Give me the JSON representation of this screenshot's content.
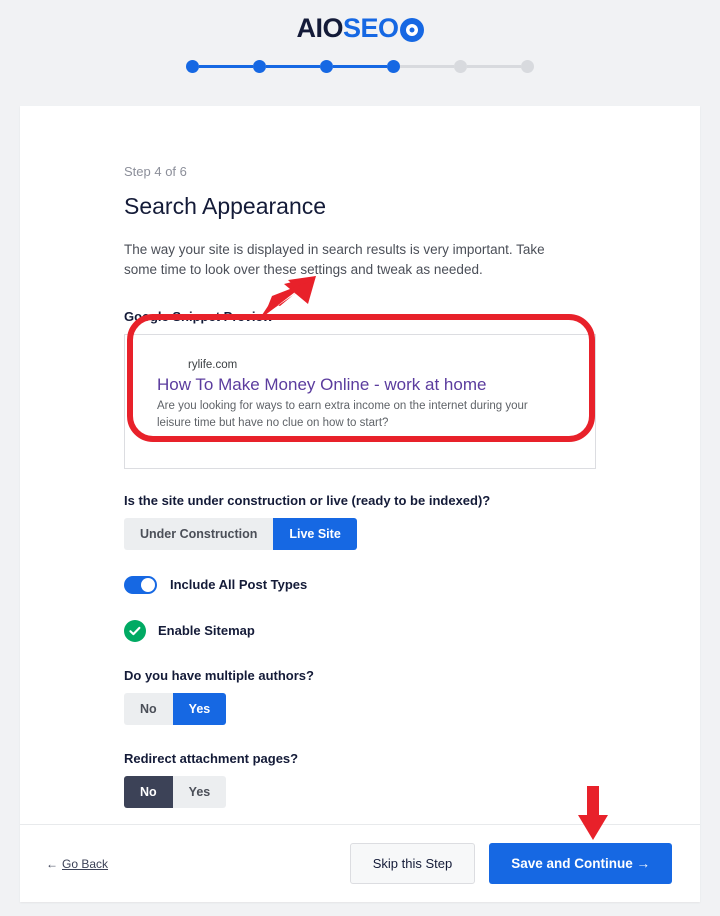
{
  "brand": {
    "name_part1": "AIO",
    "name_part2": "SEO",
    "gear_icon": "gear-icon",
    "color_dark": "#141b38",
    "color_blue": "#1668e3"
  },
  "stepper": {
    "total_steps": 6,
    "completed": 4,
    "dots": [
      "done",
      "done",
      "done",
      "done",
      "todo",
      "todo"
    ]
  },
  "main": {
    "step_label": "Step 4 of 6",
    "title": "Search Appearance",
    "intro": "The way your site is displayed in search results is very important. Take some time to look over these settings and tweak as needed.",
    "snippet_section_label": "Google Snippet Preview",
    "snippet": {
      "url": "rylife.com",
      "title": "How To Make Money Online - work at home",
      "description": "Are you looking for ways to earn extra income on the internet during your leisure time but have no clue on how to start?",
      "title_color": "#5b3c9e"
    },
    "questions": [
      {
        "label": "Is the site under construction or live (ready to be indexed)?",
        "options": [
          "Under Construction",
          "Live Site"
        ],
        "selected": "Live Site",
        "selected_style": "blue"
      },
      {
        "label": "Do you have multiple authors?",
        "options": [
          "No",
          "Yes"
        ],
        "selected": "Yes",
        "selected_style": "blue"
      },
      {
        "label": "Redirect attachment pages?",
        "options": [
          "No",
          "Yes"
        ],
        "selected": "No",
        "selected_style": "dark"
      }
    ],
    "switch_setting": {
      "label": "Include All Post Types",
      "state": "on",
      "color": "#1668e3"
    },
    "check_setting": {
      "label": "Enable Sitemap",
      "state": "checked",
      "color": "#00aa63"
    }
  },
  "footer": {
    "back_arrow": "←",
    "back_label": "Go Back",
    "skip_label": "Skip this Step",
    "primary_label": "Save and Continue →"
  },
  "annotations": {
    "highlight_color": "#e8212a",
    "arrow_to_snippet": "red-arrow-diagonal",
    "arrow_to_save": "red-arrow-down",
    "rect_around_snippet": "red-highlight-rectangle"
  }
}
